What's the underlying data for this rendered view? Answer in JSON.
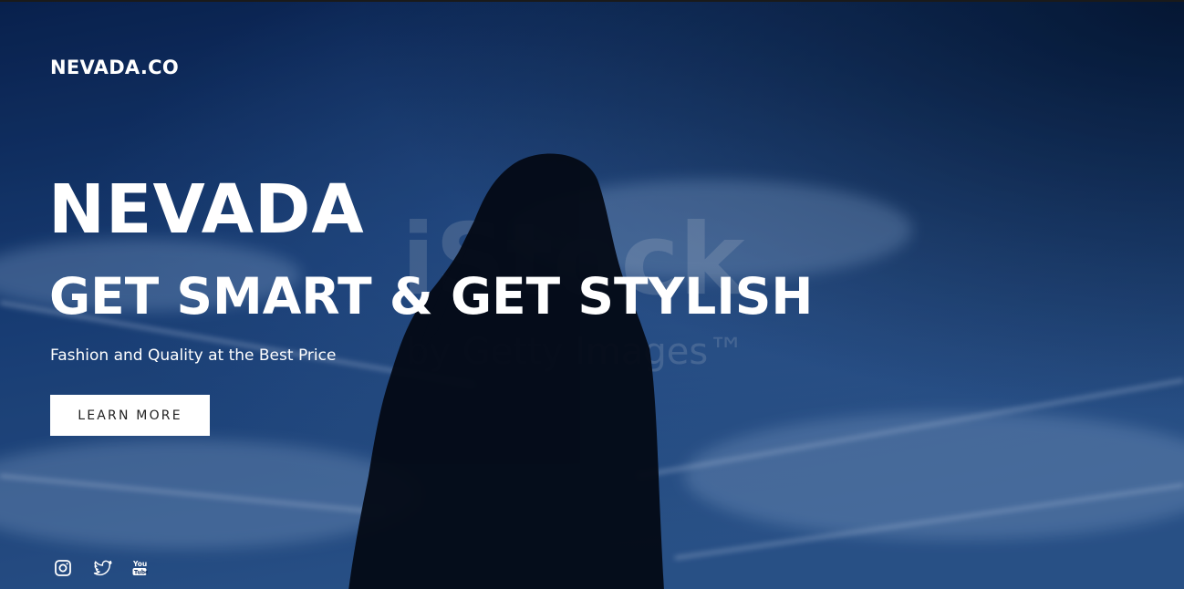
{
  "brand": {
    "name": "NEVADA.CO"
  },
  "hero": {
    "headline_primary": "NEVADA",
    "headline_secondary": "GET SMART & GET STYLISH",
    "tagline": "Fashion and Quality at the Best Price",
    "cta_label": "LEARN MORE"
  },
  "background": {
    "watermark_top": "iStock",
    "watermark_bottom": "by Getty Images™"
  },
  "social": [
    {
      "icon": "instagram-icon"
    },
    {
      "icon": "twitter-icon"
    },
    {
      "icon": "youtube-icon"
    }
  ],
  "colors": {
    "sky_dark": "#071b3d",
    "sky_mid": "#1c4587",
    "silhouette": "#050b18",
    "text": "#ffffff",
    "button_bg": "#ffffff",
    "button_text": "#1f1f1f"
  }
}
